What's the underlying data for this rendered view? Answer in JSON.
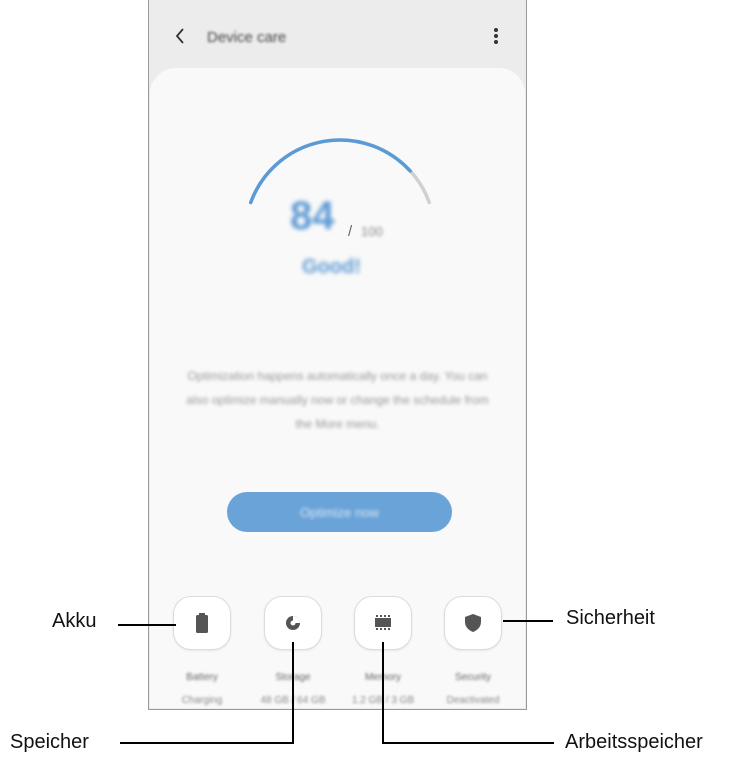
{
  "app_bar": {
    "back_icon": "chevron-left-icon",
    "title": "Device care",
    "more_icon": "more-vertical-icon"
  },
  "score": {
    "value": "84",
    "slash": "/",
    "max": "100",
    "status": "Good!",
    "gauge_fraction": 0.84,
    "gauge_color": "#5b9bd5",
    "track_color": "#d0d0d0"
  },
  "description": "Optimization happens automatically once a day. You can also optimize manually now or change the schedule from the More menu.",
  "optimize_button": "Optimize now",
  "categories": [
    {
      "icon": "battery-icon",
      "label": "Battery",
      "sub": "Charging"
    },
    {
      "icon": "storage-pie-icon",
      "label": "Storage",
      "sub": "48 GB / 64 GB"
    },
    {
      "icon": "memory-chip-icon",
      "label": "Memory",
      "sub": "1.2 GB / 3 GB"
    },
    {
      "icon": "shield-icon",
      "label": "Security",
      "sub": "Deactivated"
    }
  ],
  "callouts": {
    "akku": "Akku",
    "sicherheit": "Sicherheit",
    "speicher": "Speicher",
    "arbeitsspeicher": "Arbeitsspeicher"
  },
  "colors": {
    "accent": "#5f9ad4",
    "button": "#6aa3d8",
    "icon": "#555555"
  }
}
